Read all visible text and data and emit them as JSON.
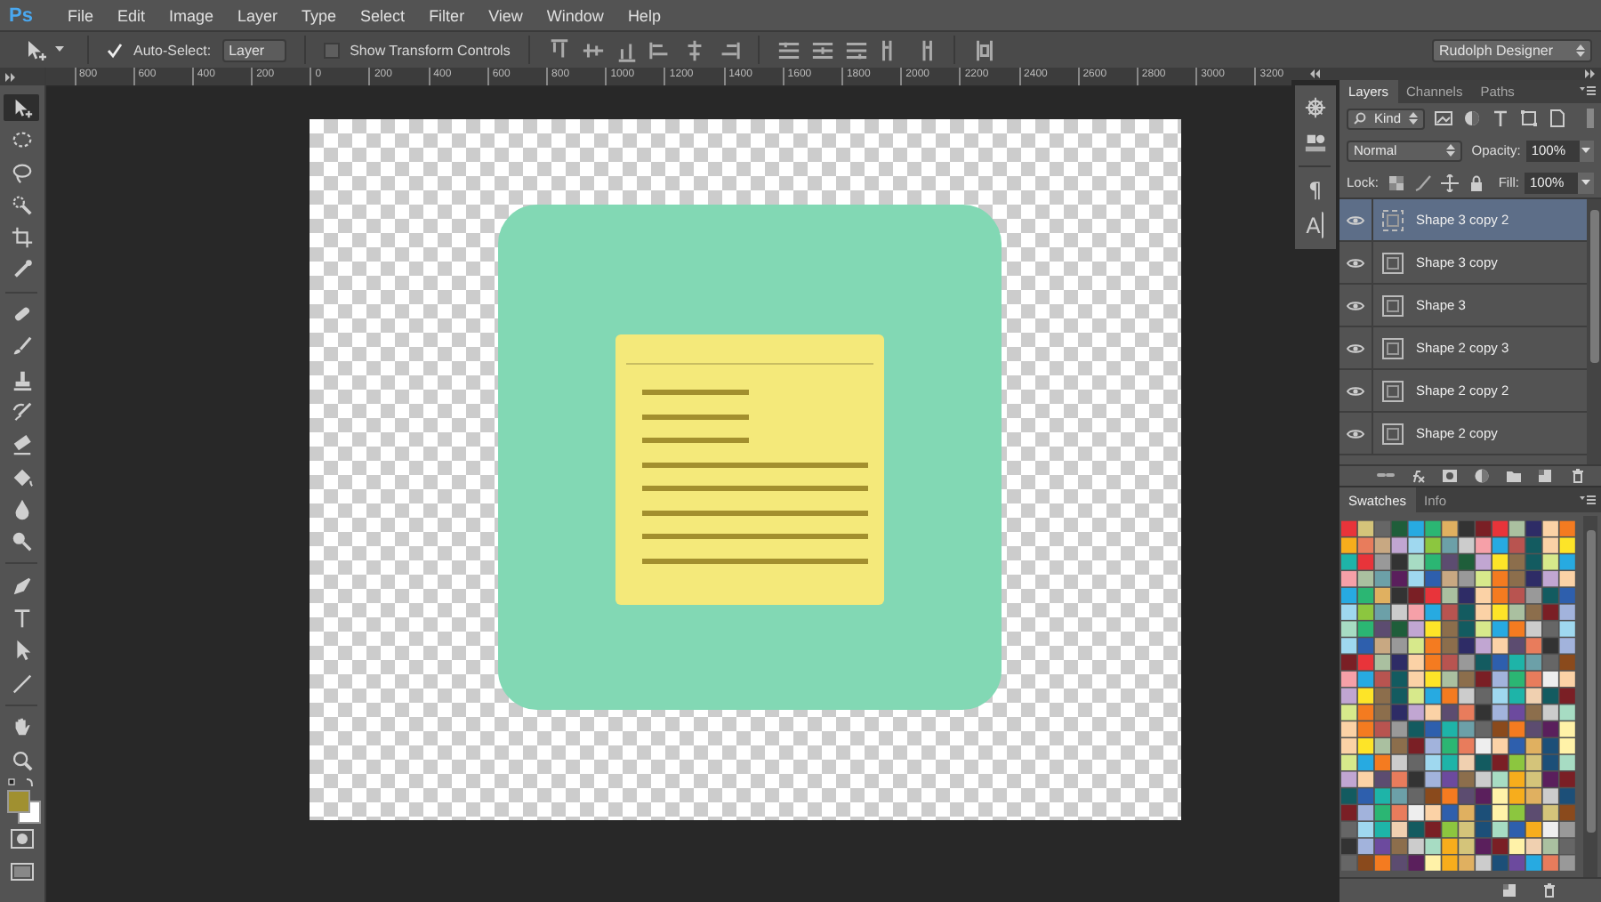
{
  "menu": {
    "logo": "Ps",
    "items": [
      "File",
      "Edit",
      "Image",
      "Layer",
      "Type",
      "Select",
      "Filter",
      "View",
      "Window",
      "Help"
    ]
  },
  "options_bar": {
    "auto_select": {
      "label": "Auto-Select:",
      "checked": true
    },
    "target": "Layer",
    "transform_controls": {
      "label": "Show Transform Controls",
      "checked": false
    },
    "workspace": "Rudolph Designer"
  },
  "ruler": {
    "labels": [
      "800",
      "600",
      "400",
      "200",
      "0",
      "200",
      "400",
      "600",
      "800",
      "1000",
      "1200",
      "1400",
      "1600",
      "1800",
      "2000",
      "2200",
      "2400",
      "2600",
      "2800",
      "3000",
      "3200"
    ]
  },
  "toolbar": {
    "tools": [
      {
        "kind": "move",
        "selected": true
      },
      {
        "kind": "marquee",
        "selected": false
      },
      {
        "kind": "lasso",
        "selected": false
      },
      {
        "kind": "quick-select",
        "selected": false
      },
      {
        "kind": "crop",
        "selected": false
      },
      {
        "kind": "eyedropper",
        "selected": false
      },
      {
        "kind": "healing",
        "selected": false
      },
      {
        "kind": "brush",
        "selected": false
      },
      {
        "kind": "stamp",
        "selected": false
      },
      {
        "kind": "history-brush",
        "selected": false
      },
      {
        "kind": "eraser",
        "selected": false
      },
      {
        "kind": "bucket",
        "selected": false
      },
      {
        "kind": "blur",
        "selected": false
      },
      {
        "kind": "dodge",
        "selected": false
      },
      {
        "kind": "pen",
        "selected": false
      },
      {
        "kind": "type",
        "selected": false
      },
      {
        "kind": "path-select",
        "selected": false
      },
      {
        "kind": "line",
        "selected": false
      },
      {
        "kind": "hand",
        "selected": false
      },
      {
        "kind": "zoom",
        "selected": false
      }
    ],
    "color_chips": [
      {
        "kind": "foreground",
        "color": "#a09030"
      },
      {
        "kind": "background",
        "color": "#ffffff"
      }
    ]
  },
  "dock": {
    "glyphs": [
      "¶",
      "A"
    ]
  },
  "layers_panel": {
    "tabs": [
      {
        "label": "Layers",
        "selected": true
      },
      {
        "label": "Channels",
        "selected": false
      },
      {
        "label": "Paths",
        "selected": false
      }
    ],
    "filter": "Kind",
    "blend_mode": "Normal",
    "opacity_label": "Opacity:",
    "opacity": "100%",
    "lock_label": "Lock:",
    "fill_label": "Fill:",
    "fill": "100%",
    "layers": [
      {
        "name": "Shape 3 copy 2",
        "visible": true,
        "selected": true
      },
      {
        "name": "Shape 3 copy",
        "visible": true,
        "selected": false
      },
      {
        "name": "Shape 3",
        "visible": true,
        "selected": false
      },
      {
        "name": "Shape 2 copy 3",
        "visible": true,
        "selected": false
      },
      {
        "name": "Shape 2 copy 2",
        "visible": true,
        "selected": false
      },
      {
        "name": "Shape 2 copy",
        "visible": true,
        "selected": false
      }
    ]
  },
  "swatches_panel": {
    "tabs": [
      {
        "label": "Swatches",
        "selected": true
      },
      {
        "label": "Info",
        "selected": false
      }
    ]
  }
}
